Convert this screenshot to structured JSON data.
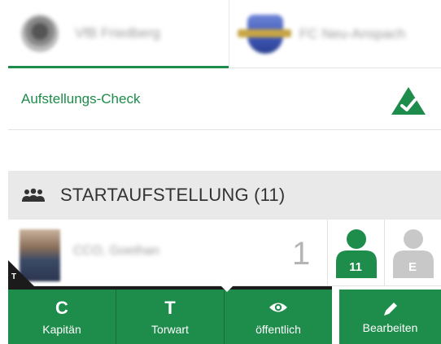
{
  "tabs": {
    "home": {
      "name": "VfB Friedberg",
      "logo_icon": "team-crest-icon",
      "active": true
    },
    "away": {
      "name": "FC Neu-Anspach",
      "logo_icon": "team-crest-icon",
      "active": false
    }
  },
  "check": {
    "label": "Aufstellungs-Check",
    "icon": "check-triangle-icon",
    "status": "ok"
  },
  "section": {
    "title": "STARTAUFSTELLUNG (11)",
    "icon": "group-people-icon"
  },
  "player": {
    "name": "CCO, Goethan",
    "number": "1",
    "corner_letter": "T",
    "roles": [
      {
        "badge": "11",
        "icon": "player-starter-icon",
        "color": "#1e8c4a"
      },
      {
        "badge": "E",
        "icon": "player-substitute-icon",
        "color": "#c8c8c8"
      }
    ]
  },
  "bottom_bar": {
    "buttons": [
      {
        "glyph": "C",
        "label": "Kapitän"
      },
      {
        "glyph": "T",
        "label": "Torwart"
      },
      {
        "glyph": "eye-icon",
        "label": "öffentlich"
      }
    ],
    "edit": {
      "glyph": "pencil-icon",
      "label": "Bearbeiten"
    }
  },
  "colors": {
    "accent": "#1e8c4a",
    "section_bg": "#e9e9e9",
    "dark": "#1b1b1b"
  }
}
